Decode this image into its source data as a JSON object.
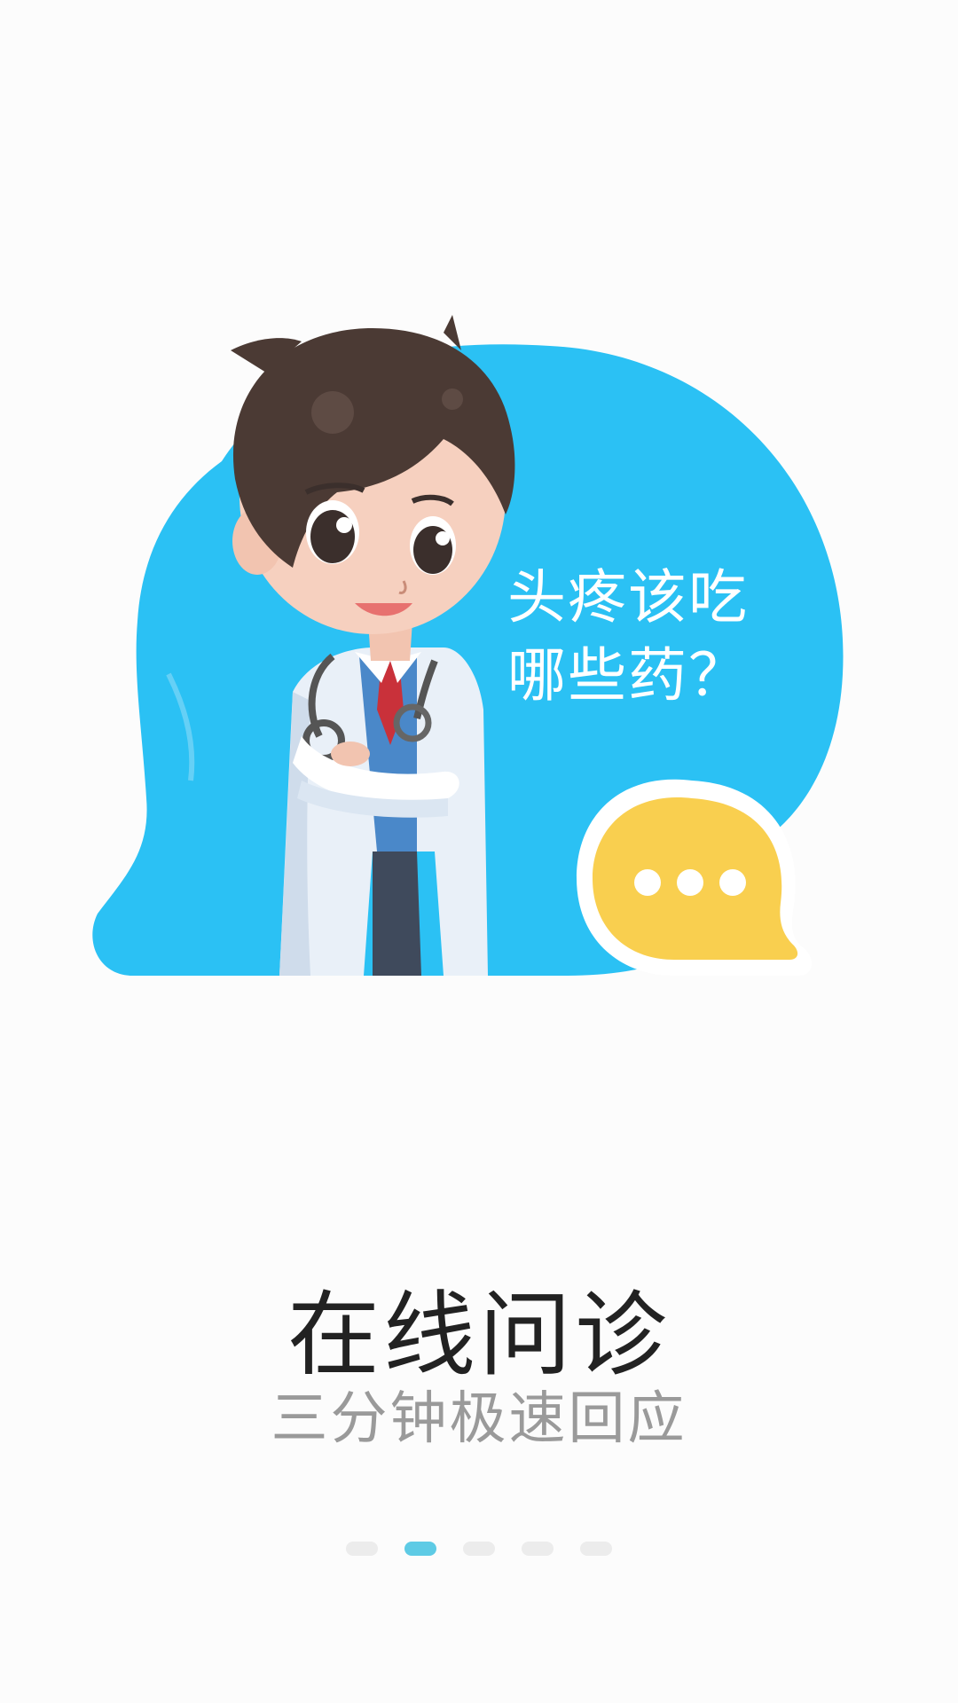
{
  "illustration": {
    "speech_line1": "头疼该吃",
    "speech_line2": "哪些药？",
    "bubble_color": "#2bc1f4",
    "chat_bubble_color": "#f9cf4f",
    "chat_icon": "ellipsis-chat-icon"
  },
  "feature": {
    "title": "在线问诊",
    "subtitle": "三分钟极速回应"
  },
  "pager": {
    "total_pages": 5,
    "current_page": 2,
    "active_color": "#5ecbe5",
    "inactive_color": "#ececec"
  }
}
